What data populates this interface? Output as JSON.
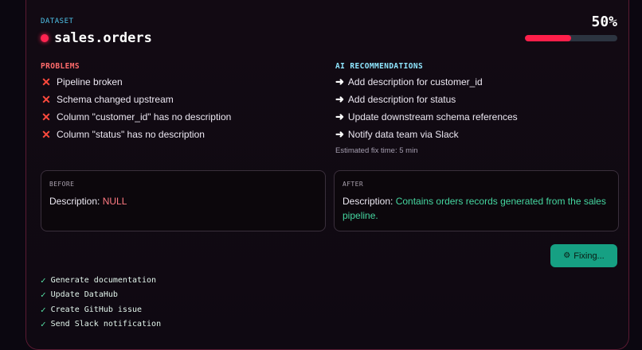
{
  "dataset": {
    "label": "DATASET",
    "name": "sales.orders"
  },
  "progress": {
    "percent_text": "50%",
    "value": 0.5
  },
  "problems": {
    "title": "PROBLEMS",
    "items": [
      "Pipeline broken",
      "Schema changed upstream",
      "Column \"customer_id\" has no description",
      "Column \"status\" has no description"
    ]
  },
  "ai": {
    "title": "AI RECOMMENDATIONS",
    "items": [
      "Add description for customer_id",
      "Add description for status",
      "Update downstream schema references",
      "Notify data team via Slack"
    ],
    "estimate": "Estimated fix time: 5 min"
  },
  "before": {
    "label": "BEFORE",
    "prefix": "Description:",
    "value": "NULL"
  },
  "after": {
    "label": "AFTER",
    "prefix": "Description:",
    "value": "Contains orders records generated from the sales pipeline."
  },
  "fix_button": {
    "label": "Fixing..."
  },
  "steps": [
    "Generate documentation",
    "Update DataHub",
    "Create GitHub issue",
    "Send Slack notification"
  ],
  "colors": {
    "accent": "#ff1f4a",
    "cyan": "#4fc3ea",
    "success": "#16a083"
  },
  "icons": {
    "problem": "x-icon",
    "recommendation": "arrow-right-icon",
    "status_dot": "red-dot-icon",
    "button": "gear-icon",
    "step": "check-icon"
  }
}
